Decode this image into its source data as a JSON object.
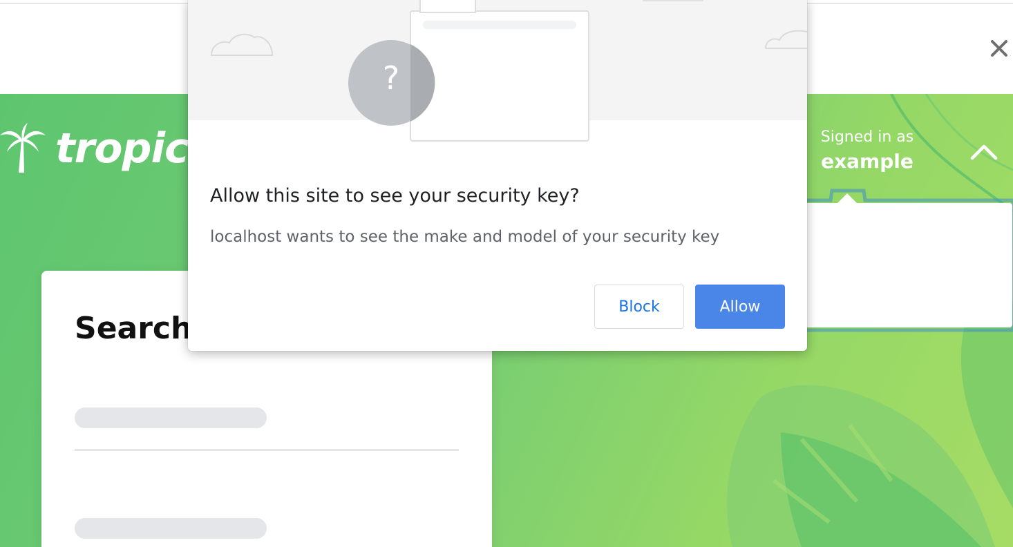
{
  "browser": {
    "close_icon": "close-icon"
  },
  "site": {
    "logo_icon": "palm-tree-icon",
    "logo_text": "tropica",
    "account": {
      "signed_in_label": "Signed in as",
      "username": "example",
      "toggle_icon": "chevron-up-icon"
    },
    "search_card": {
      "title": "Search"
    }
  },
  "permission_dialog": {
    "illustration_icon": "question-mark-icon",
    "question_mark": "?",
    "title": "Allow this site to see your security key?",
    "body": "localhost wants to see the make and model of your security key",
    "block_label": "Block",
    "allow_label": "Allow"
  },
  "colors": {
    "hero_green": "#6cc873",
    "accent_blue": "#4a86e8",
    "link_blue": "#1a73e8"
  }
}
